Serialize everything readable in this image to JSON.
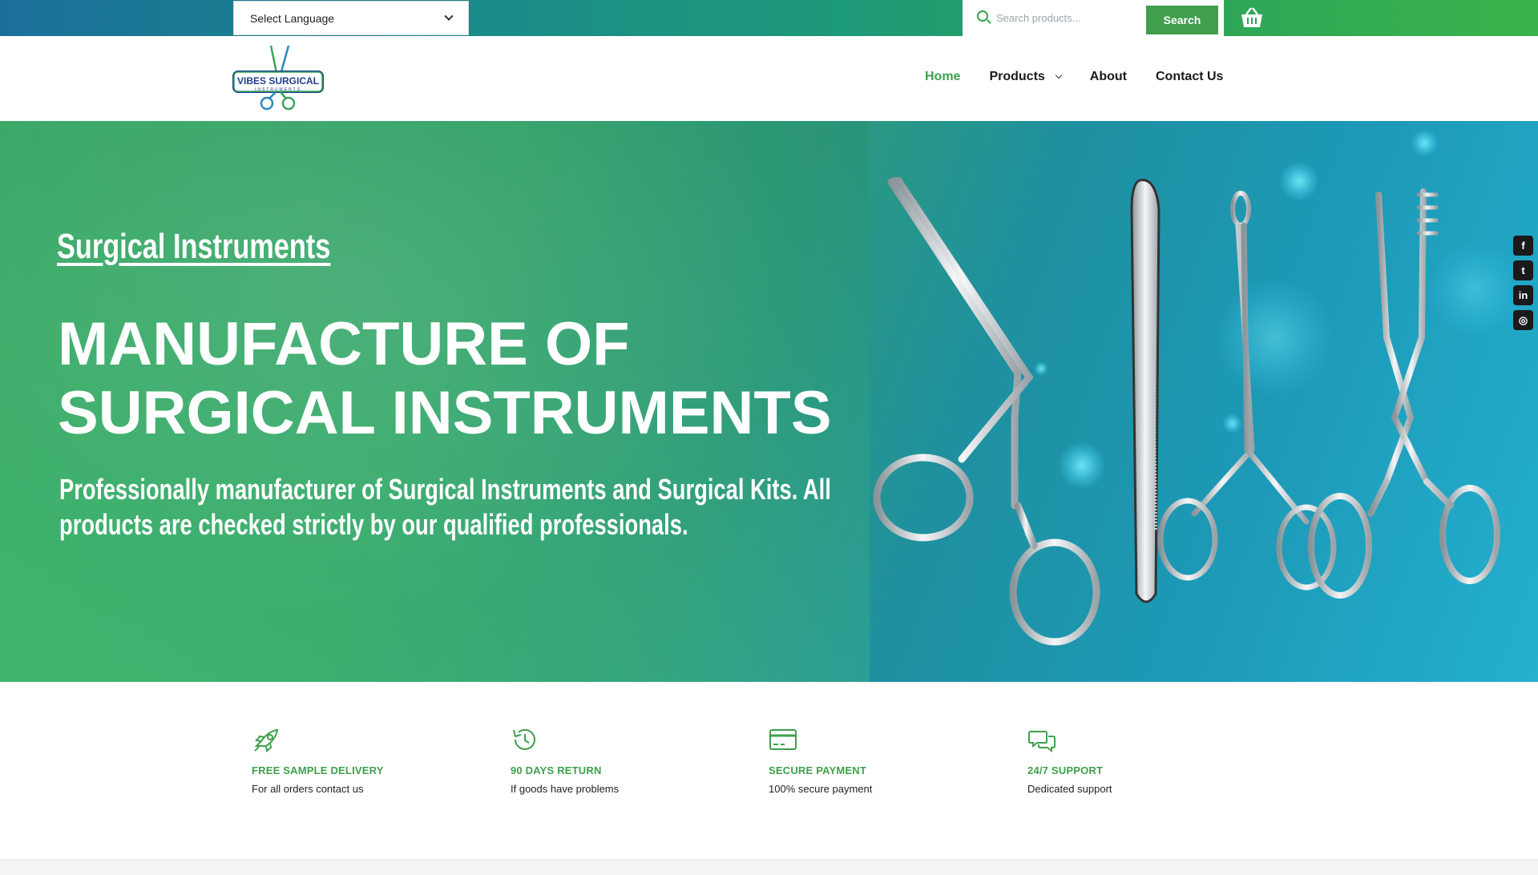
{
  "topbar": {
    "language_label": "Select Language",
    "search_placeholder": "Search products...",
    "search_button": "Search"
  },
  "header": {
    "logo_text": "VIBES SURGICAL",
    "logo_subtext": "INSTRUMENTS",
    "nav": [
      {
        "label": "Home"
      },
      {
        "label": "Products"
      },
      {
        "label": "About"
      },
      {
        "label": "Contact Us"
      }
    ]
  },
  "hero": {
    "subtitle": "Surgical Instruments",
    "title_line1": "MANUFACTURE OF",
    "title_line2": "SURGICAL INSTRUMENTS",
    "description": "Professionally manufacturer of Surgical Instruments and Surgical Kits. All products are checked strictly by our qualified professionals."
  },
  "social": [
    "facebook-icon",
    "twitter-icon",
    "linkedin-icon",
    "instagram-icon"
  ],
  "features": [
    {
      "icon": "rocket-icon",
      "title": "FREE SAMPLE DELIVERY",
      "desc": "For all orders contact us"
    },
    {
      "icon": "history-icon",
      "title": "90 DAYS RETURN",
      "desc": "If goods have problems"
    },
    {
      "icon": "credit-card-icon",
      "title": "SECURE PAYMENT",
      "desc": "100% secure payment"
    },
    {
      "icon": "chat-icon",
      "title": "24/7 SUPPORT",
      "desc": "Dedicated support"
    }
  ],
  "colors": {
    "accent": "#3f9f4c",
    "topbar_start": "#1a6f9a",
    "topbar_end": "#3bb34a"
  }
}
